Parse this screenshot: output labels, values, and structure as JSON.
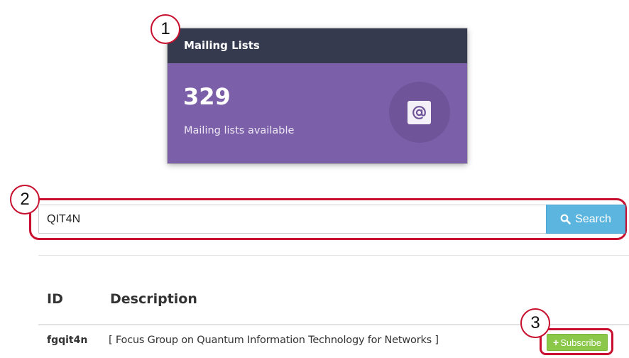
{
  "card": {
    "title": "Mailing Lists",
    "count": "329",
    "subtitle": "Mailing lists available",
    "icon": "at-sign-icon",
    "colors": {
      "header": "#363a4f",
      "body": "#7b5fa8"
    }
  },
  "markers": {
    "one": "1",
    "two": "2",
    "three": "3",
    "color": "#c8102e"
  },
  "search": {
    "value": "QIT4N",
    "button_label": "Search",
    "icon": "search-icon",
    "button_color": "#5bb5de"
  },
  "table": {
    "headers": {
      "id": "ID",
      "description": "Description"
    },
    "rows": [
      {
        "id": "fgqit4n",
        "description": "[ Focus Group on Quantum Information Technology for Networks ]",
        "action_label": "Subscribe",
        "action_icon": "plus-icon",
        "action_color": "#8bc84a"
      }
    ]
  }
}
